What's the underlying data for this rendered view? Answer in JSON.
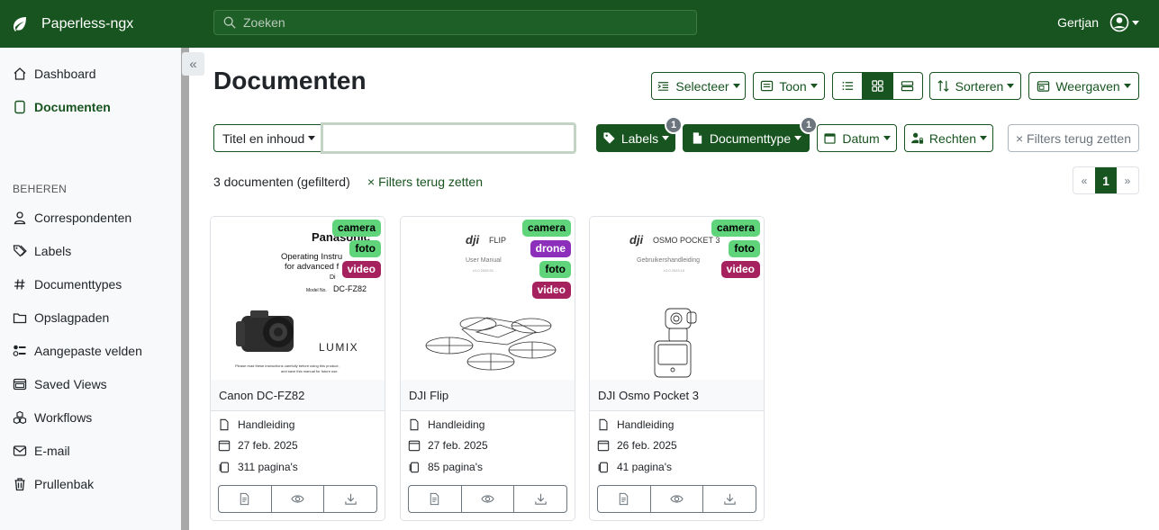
{
  "app": {
    "name": "Paperless-ngx",
    "user": "Gertjan"
  },
  "search": {
    "placeholder": "Zoeken"
  },
  "sidebar": {
    "items": [
      {
        "label": "Dashboard",
        "icon": "house-icon"
      },
      {
        "label": "Documenten",
        "icon": "file-icon",
        "active": true
      }
    ],
    "section_label": "BEHEREN",
    "manage_items": [
      {
        "label": "Correspondenten",
        "icon": "person-icon"
      },
      {
        "label": "Labels",
        "icon": "tags-icon"
      },
      {
        "label": "Documenttypes",
        "icon": "hash-icon"
      },
      {
        "label": "Opslagpaden",
        "icon": "folder-icon"
      },
      {
        "label": "Aangepaste velden",
        "icon": "ui-radios-icon"
      },
      {
        "label": "Saved Views",
        "icon": "window-icon"
      },
      {
        "label": "Workflows",
        "icon": "boxes-icon"
      },
      {
        "label": "E-mail",
        "icon": "envelope-icon"
      },
      {
        "label": "Prullenbak",
        "icon": "trash-icon"
      }
    ]
  },
  "page": {
    "title": "Documenten"
  },
  "toolbar": {
    "select_label": "Selecteer",
    "show_label": "Toon",
    "sort_label": "Sorteren",
    "views_label": "Weergaven",
    "view_mode": "small-cards"
  },
  "filters": {
    "text_mode": "Titel en inhoud",
    "text_value": "",
    "labels_label": "Labels",
    "labels_count": "1",
    "doctype_label": "Documenttype",
    "doctype_count": "1",
    "date_label": "Datum",
    "permissions_label": "Rechten",
    "reset_label": "× Filters terug zetten"
  },
  "results": {
    "count_text": "3 documenten (gefilterd)",
    "reset_link": "× Filters terug zetten"
  },
  "pagination": {
    "prev": "«",
    "current": "1",
    "next": "»"
  },
  "colors": {
    "brand": "#17541f",
    "tag_green": "#5fd47a",
    "tag_purple": "#8c2fba",
    "tag_magenta": "#a5225f"
  },
  "documents": [
    {
      "title": "Canon DC-FZ82",
      "tags": [
        {
          "name": "camera",
          "bg": "#5fd47a",
          "fg": "#000000"
        },
        {
          "name": "foto",
          "bg": "#5fd47a",
          "fg": "#000000"
        },
        {
          "name": "video",
          "bg": "#a5225f",
          "fg": "#ffffff"
        }
      ],
      "doctype": "Handleiding",
      "date": "27 feb. 2025",
      "pages": "311 pagina's",
      "thumb": {
        "brand": "Panasonic",
        "line1": "Operating Instru",
        "line2": "for advanced f",
        "line3": "Di",
        "model_label": "Model No.",
        "model": "DC-FZ82",
        "logo": "LUMIX",
        "foot1": "Please read these instructions carefully before using this product,",
        "foot2": "and save this manual for future use."
      }
    },
    {
      "title": "DJI Flip",
      "tags": [
        {
          "name": "camera",
          "bg": "#5fd47a",
          "fg": "#000000"
        },
        {
          "name": "drone",
          "bg": "#8c2fba",
          "fg": "#ffffff"
        },
        {
          "name": "foto",
          "bg": "#5fd47a",
          "fg": "#000000"
        },
        {
          "name": "video",
          "bg": "#a5225f",
          "fg": "#ffffff"
        }
      ],
      "doctype": "Handleiding",
      "date": "27 feb. 2025",
      "pages": "85 pagina's",
      "thumb": {
        "logo": "dji",
        "product": "FLIP",
        "subtitle": "User Manual",
        "version": "v1.0 2025.01"
      }
    },
    {
      "title": "DJI Osmo Pocket 3",
      "tags": [
        {
          "name": "camera",
          "bg": "#5fd47a",
          "fg": "#000000"
        },
        {
          "name": "foto",
          "bg": "#5fd47a",
          "fg": "#000000"
        },
        {
          "name": "video",
          "bg": "#a5225f",
          "fg": "#ffffff"
        }
      ],
      "doctype": "Handleiding",
      "date": "26 feb. 2025",
      "pages": "41 pagina's",
      "thumb": {
        "logo": "dji",
        "product": "OSMO POCKET 3",
        "subtitle": "Gebruikershandleiding",
        "version": "v1.0 2023.10"
      }
    }
  ]
}
